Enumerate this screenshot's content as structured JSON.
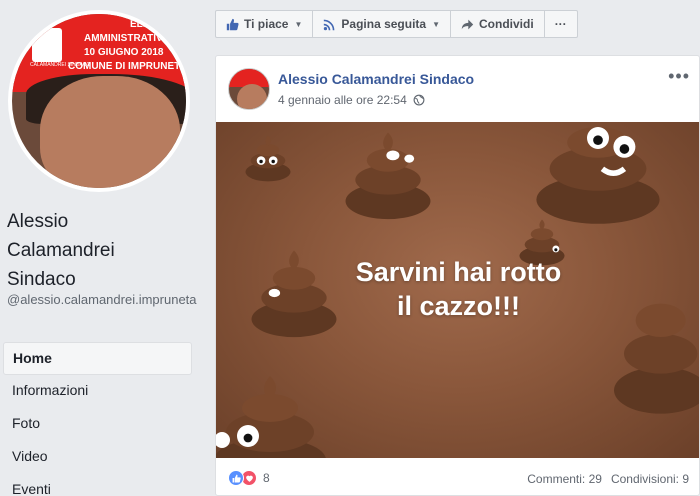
{
  "profile": {
    "name_lines": [
      "Alessio",
      "Calamandrei",
      "Sindaco"
    ],
    "handle": "@alessio.calamandrei.impruneta",
    "avatar_text": [
      "ELEZ",
      "AMMINISTRATIV",
      "10 GIUGNO 2018",
      "COMUNE DI IMPRUNETA"
    ],
    "avatar_logo_text": "CALAMANDREI SINDACO"
  },
  "nav": {
    "items": [
      "Home",
      "Informazioni",
      "Foto",
      "Video",
      "Eventi"
    ],
    "active": "Home"
  },
  "actionbar": {
    "like_label": "Ti piace",
    "follow_label": "Pagina seguita",
    "share_label": "Condividi",
    "more_label": "···"
  },
  "post": {
    "author": "Alessio Calamandrei Sindaco",
    "timestamp": "4 gennaio alle ore 22:54",
    "more_label": "•••",
    "image_text_line1": "Sarvini hai rotto",
    "image_text_line2": "il cazzo!!!",
    "reaction_count": "8",
    "comments": "Commenti: 29",
    "shares": "Condivisioni: 9"
  },
  "colors": {
    "link_blue": "#385898",
    "like_blue": "#5890ff",
    "love_red": "#f25268",
    "brown_bg": "#8a573b",
    "banner_red": "#e42320"
  }
}
